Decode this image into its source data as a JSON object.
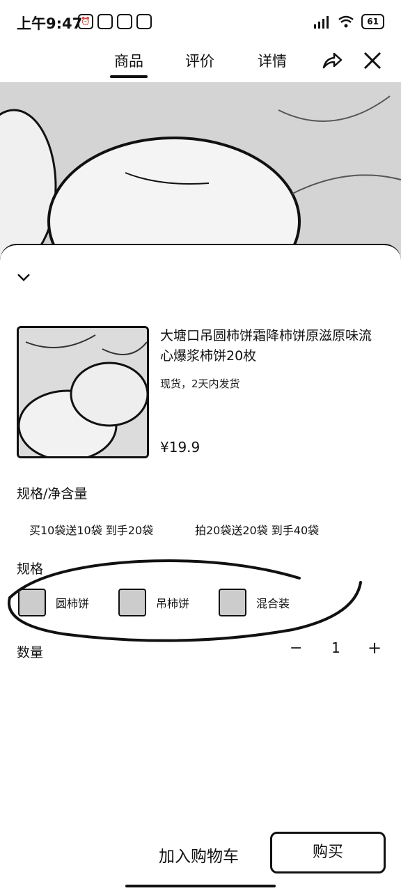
{
  "status_bar": {
    "time": "上午9:47",
    "battery": "61"
  },
  "nav": {
    "tabs": [
      {
        "label": "商品"
      },
      {
        "label": "评价"
      },
      {
        "label": "详情"
      }
    ]
  },
  "product": {
    "title": "大塘口吊圆柿饼霜降柿饼原滋原味流心爆浆柿饼20枚",
    "stock_note": "现货，2天内发货",
    "price": "¥19.9"
  },
  "net_content": {
    "label": "规格/净含量",
    "options": [
      "买10袋送10袋 到手20袋",
      "拍20袋送20袋 到手40袋"
    ]
  },
  "spec": {
    "label": "规格",
    "options": [
      "圆柿饼",
      "吊柿饼",
      "混合装"
    ]
  },
  "quantity": {
    "label": "数量",
    "minus": "−",
    "value": "1",
    "plus": "+"
  },
  "actions": {
    "add_to_cart": "加入购物车",
    "buy": "购买"
  }
}
